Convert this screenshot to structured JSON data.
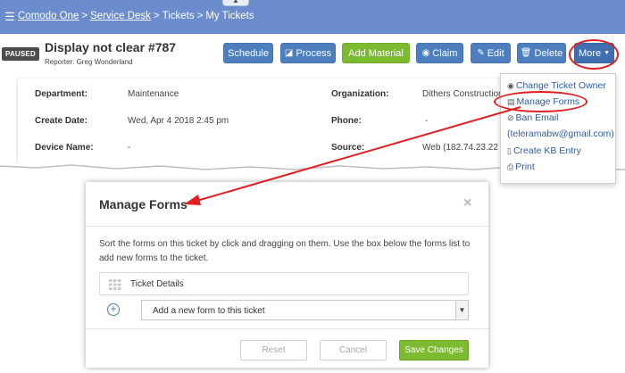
{
  "topbar": {
    "crumbs": [
      "Comodo One",
      "Service Desk",
      "Tickets",
      "My Tickets"
    ],
    "separator": ">"
  },
  "ticket": {
    "status": "PAUSED",
    "title": "Display not clear #787",
    "reporter": "Reporter: Greg Wonderland"
  },
  "toolbar": {
    "schedule": "Schedule",
    "process": "Process",
    "add_material": "Add Material",
    "claim": "Claim",
    "edit": "Edit",
    "delete": "Delete",
    "more": "More"
  },
  "details": {
    "department_label": "Department:",
    "department_value": "Maintenance",
    "organization_label": "Organization:",
    "organization_value": "Dithers Construction",
    "create_date_label": "Create Date:",
    "create_date_value": "Wed, Apr 4 2018 2:45 pm",
    "phone_label": "Phone:",
    "phone_value": "-",
    "device_name_label": "Device Name:",
    "device_name_value": "-",
    "source_label": "Source:",
    "source_value": "Web   (182.74.23.22"
  },
  "more_menu": {
    "items": [
      "Change Ticket Owner",
      "Manage Forms",
      "Ban Email",
      "(teleramabw@gmail.com)",
      "Create KB Entry",
      "Print"
    ]
  },
  "modal": {
    "title": "Manage Forms",
    "close": "×",
    "description": "Sort the forms on this ticket by click and dragging on them. Use the box below the forms list to add new forms to the ticket.",
    "forms": [
      "Ticket Details"
    ],
    "add_placeholder": "Add a new form to this ticket",
    "reset": "Reset",
    "cancel": "Cancel",
    "save": "Save Changes"
  },
  "colors": {
    "topbar": "#6b8ccd",
    "button_blue": "#4d7ebd",
    "button_green": "#7cbb2f",
    "annotation_red": "#e02020"
  }
}
